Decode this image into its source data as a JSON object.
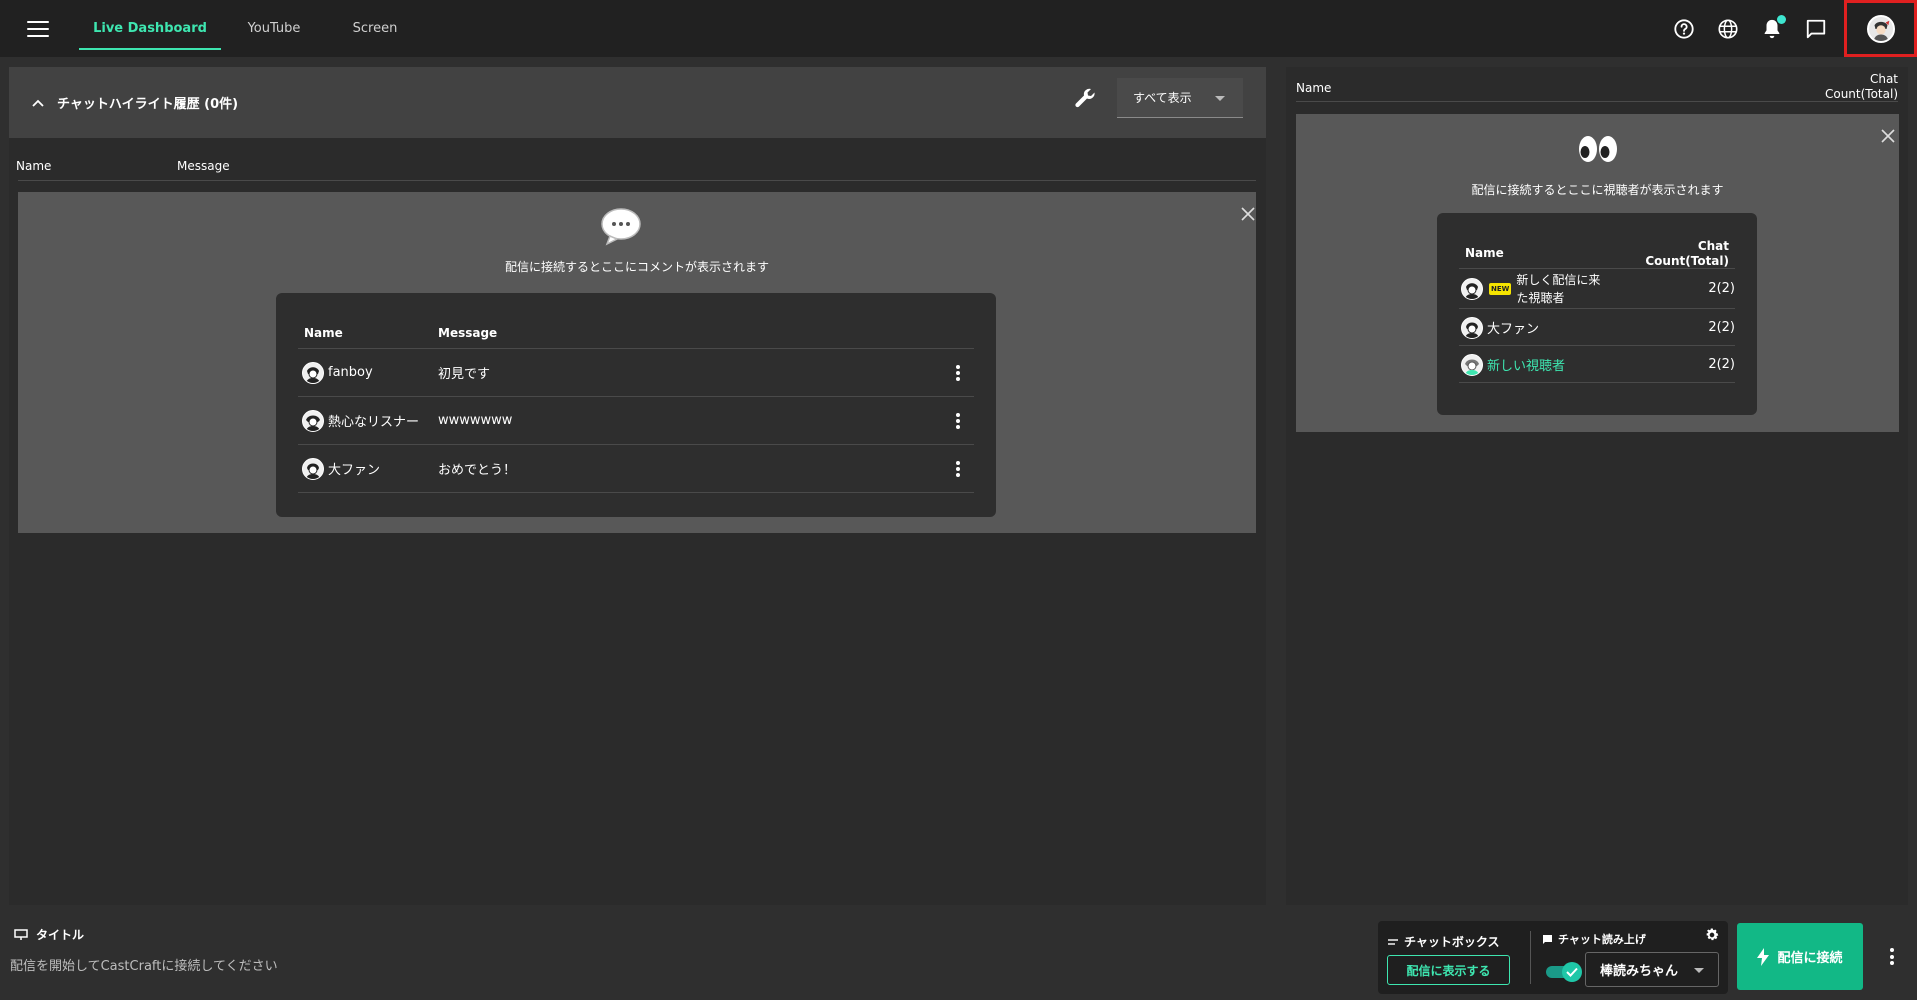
{
  "nav": {
    "tabs": [
      {
        "label": "Live Dashboard",
        "active": true
      },
      {
        "label": "YouTube",
        "active": false
      },
      {
        "label": "Screen",
        "active": false
      }
    ],
    "icons": [
      "help-icon",
      "globe-icon",
      "bell-icon",
      "chat-icon",
      "avatar"
    ]
  },
  "highlight": {
    "title": "チャットハイライト履歴 (0件)",
    "filter_label": "すべて表示"
  },
  "chat_table": {
    "headers": {
      "name": "Name",
      "message": "Message"
    },
    "empty_message": "配信に接続するとここにコメントが表示されます",
    "sample": {
      "headers": {
        "name": "Name",
        "message": "Message"
      },
      "rows": [
        {
          "name": "fanboy",
          "message": "初見です"
        },
        {
          "name": "熱心なリスナー",
          "message": "wwwwwww"
        },
        {
          "name": "大ファン",
          "message": "おめでとう！"
        }
      ]
    }
  },
  "viewers": {
    "headers": {
      "name": "Name",
      "count_line1": "Chat",
      "count_line2": "Count(Total)"
    },
    "empty_message": "配信に接続するとここに視聴者が表示されます",
    "sample": {
      "headers": {
        "name": "Name",
        "count_line1": "Chat",
        "count_line2": "Count(Total)"
      },
      "rows": [
        {
          "badge": "NEW",
          "name_line1": "新しく配信に来",
          "name_line2": "た視聴者",
          "count": "2(2)"
        },
        {
          "name": "大ファン",
          "count": "2(2)"
        },
        {
          "name": "新しい視聴者",
          "count": "2(2)",
          "highlight_color": "#3ee6b0"
        }
      ]
    }
  },
  "bottom": {
    "title_label": "タイトル",
    "status_text": "配信を開始してCastCraftに接続してください",
    "chatbox_label": "チャットボックス",
    "show_on_stream_label": "配信に表示する",
    "tts_label": "チャット読み上げ",
    "tts_voice": "棒読みちゃん",
    "connect_label": "配信に接続"
  },
  "colors": {
    "accent": "#3ee6b0",
    "connect": "#12b886",
    "avatar_highlight_border": "#e02020",
    "new_badge": "#f5e400"
  }
}
